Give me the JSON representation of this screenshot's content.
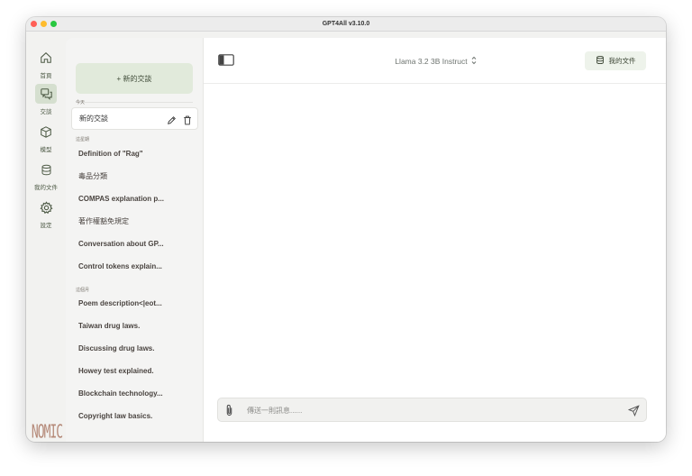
{
  "window": {
    "title": "GPT4All v3.10.0"
  },
  "nav": {
    "items": [
      {
        "label": "首頁",
        "icon": "home-icon"
      },
      {
        "label": "交談",
        "icon": "chat-bubbles-icon",
        "active": true
      },
      {
        "label": "模型",
        "icon": "cube-icon"
      },
      {
        "label": "我的文件",
        "icon": "database-icon"
      },
      {
        "label": "設定",
        "icon": "gear-icon"
      }
    ],
    "logo": "NOMIC"
  },
  "sidebar": {
    "new_chat_label": "+ 新的交談",
    "sections": [
      {
        "title": "今天"
      },
      {
        "title": "這星期"
      },
      {
        "title": "這個月"
      }
    ],
    "current_chat": "新的交談",
    "week_chats": [
      "Definition of \"Rag\"",
      "毒品分類",
      "COMPAS explanation p...",
      "著作權豁免規定",
      "Conversation about GP...",
      "Control tokens explain..."
    ],
    "month_chats": [
      "Poem description<|eot...",
      "Taiwan drug laws.",
      "Discussing drug laws.",
      "Howey test explained.",
      "Blockchain technology...",
      "Copyright law basics."
    ]
  },
  "header": {
    "model": "Llama 3.2 3B Instruct",
    "docs_label": "我的文件"
  },
  "composer": {
    "placeholder": "傳送一則訊息......"
  },
  "colors": {
    "accent_green": "#e1eadb",
    "nav_active": "#d5dfcf",
    "logo": "#b58a79"
  }
}
